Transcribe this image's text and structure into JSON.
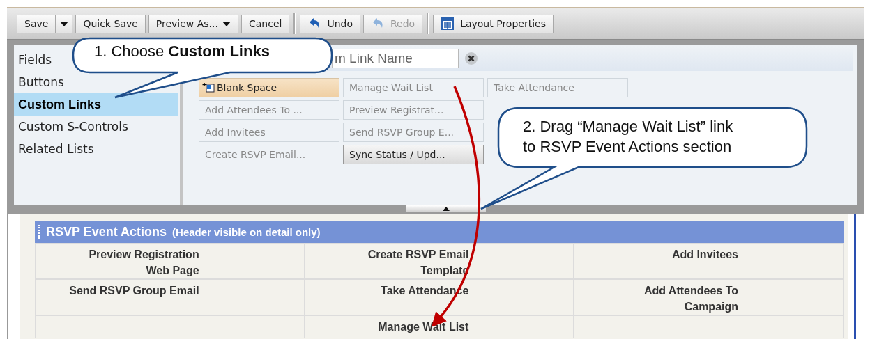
{
  "toolbar": {
    "groups": [
      [
        {
          "label": "Save",
          "kind": "split",
          "disabled": false
        },
        {
          "label": "Quick Save",
          "kind": "plain",
          "disabled": false
        },
        {
          "label": "Preview As...",
          "kind": "menu",
          "disabled": false
        },
        {
          "label": "Cancel",
          "kind": "plain",
          "disabled": false
        }
      ],
      [
        {
          "label": "Undo",
          "kind": "undo",
          "disabled": false
        },
        {
          "label": "Redo",
          "kind": "redo",
          "disabled": true
        }
      ],
      [
        {
          "label": "Layout Properties",
          "kind": "properties",
          "disabled": false
        }
      ]
    ]
  },
  "palette": {
    "categories": [
      {
        "label": "Fields",
        "selected": false
      },
      {
        "label": "Buttons",
        "selected": false
      },
      {
        "label": "Custom Links",
        "selected": true
      },
      {
        "label": "Custom S-Controls",
        "selected": false
      },
      {
        "label": "Related Lists",
        "selected": false
      }
    ],
    "search": {
      "placeholder": "m Link Name"
    },
    "link_columns": [
      [
        {
          "label": "Blank Space",
          "kind": "blank",
          "used": false
        },
        {
          "label": "Add Attendees To ...",
          "kind": "link",
          "used": true
        },
        {
          "label": "Add Invitees",
          "kind": "link",
          "used": true
        },
        {
          "label": "Create RSVP Email...",
          "kind": "link",
          "used": true
        }
      ],
      [
        {
          "label": "Manage Wait List",
          "kind": "link",
          "used": true
        },
        {
          "label": "Preview Registrat...",
          "kind": "link",
          "used": true
        },
        {
          "label": "Send RSVP Group E...",
          "kind": "link",
          "used": true
        },
        {
          "label": "Sync Status / Upd...",
          "kind": "link",
          "used": false
        }
      ],
      [
        {
          "label": "Take Attendance",
          "kind": "link",
          "used": true
        }
      ]
    ]
  },
  "section": {
    "title": "RSVP Event Actions",
    "note": "(Header visible on detail only)",
    "columns": [
      [
        "Preview Registration\nWeb Page",
        "Send RSVP Group Email"
      ],
      [
        "Create RSVP Email\nTemplate",
        "Take Attendance",
        "Manage Wait List"
      ],
      [
        "Add Invitees",
        "Add Attendees To\nCampaign"
      ]
    ]
  },
  "callouts": [
    {
      "text": "1. Choose **Custom Links**"
    },
    {
      "text": "2. Drag “Manage Wait List” link\nto RSVP Event Actions section"
    }
  ]
}
